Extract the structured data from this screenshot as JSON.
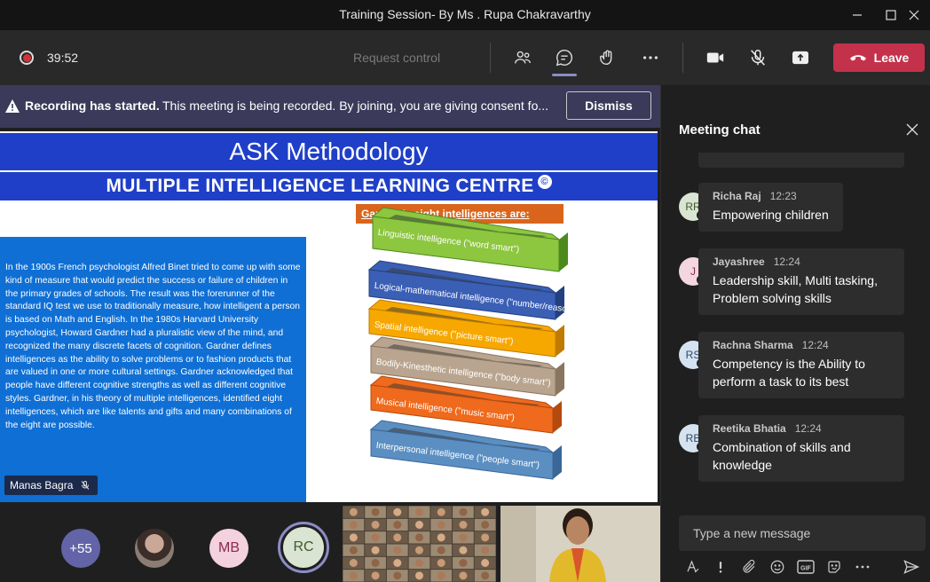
{
  "window": {
    "title": "Training Session- By Ms . Rupa Chakravarthy"
  },
  "toolbar": {
    "timer": "39:52",
    "request_control": "Request control",
    "leave_label": "Leave"
  },
  "banner": {
    "bold": "Recording has started.",
    "text": "This meeting is being recorded. By joining, you are giving consent fo...",
    "dismiss": "Dismiss"
  },
  "slide": {
    "title": "ASK Methodology",
    "subtitle": "MULTIPLE INTELLIGENCE LEARNING CENTRE",
    "copyright_mark": "©",
    "gardner_label": "Gardner's eight intelligences are:",
    "paragraph": "In the 1900s French psychologist Alfred Binet tried to come up with some kind of measure that would predict the success or failure of children in the primary grades of schools. The result was the forerunner of the standard IQ test we use to traditionally measure, how intelligent a person is based on Math and English. In the 1980s Harvard University psychologist, Howard Gardner had a pluralistic view of the mind, and recognized the many discrete facets of cognition. Gardner defines intelligences as the ability to solve problems or to fashion products that are valued in one or more cultural settings. Gardner acknowledged that people have different cognitive strengths as well as different cognitive styles. Gardner, in his theory of multiple intelligences, identified eight intelligences, which are like talents and gifts and many combinations of the eight are possible.",
    "layers": [
      {
        "label": "Linguistic intelligence (\"word smart\")",
        "color": "#8dc63f",
        "edge": "#4c8a1e"
      },
      {
        "label": "Logical-mathematical intelligence (\"number/reasoning smart\")",
        "color": "#3b5fb5",
        "edge": "#23407f"
      },
      {
        "label": "Spatial intelligence (\"picture smart\")",
        "color": "#f7a800",
        "edge": "#c17a00"
      },
      {
        "label": "Bodily-Kinesthetic intelligence (\"body smart\")",
        "color": "#b9a58f",
        "edge": "#8a7660"
      },
      {
        "label": "Musical intelligence (\"music smart\")",
        "color": "#ef6a1d",
        "edge": "#b44a0e"
      },
      {
        "label": "Interpersonal intelligence (\"people smart\")",
        "color": "#5b8fc2",
        "edge": "#3a6797"
      }
    ],
    "speaker": "Manas Bagra"
  },
  "participants": {
    "more_count": "+55",
    "mb_initials": "MB",
    "rc_initials": "RC"
  },
  "chat": {
    "title": "Meeting chat",
    "messages": [
      {
        "initials": "RR",
        "name": "Richa Raj",
        "time": "12:23",
        "text": "Empowering children",
        "status": "#c4314b",
        "avatar_bg": "#d9e4d2",
        "avatar_fg": "#3f5a2c"
      },
      {
        "initials": "J",
        "name": "Jayashree",
        "time": "12:24",
        "text": "Leadership skill, Multi tasking, Problem solving skills",
        "status": "#c4314b",
        "avatar_bg": "#f3d6df",
        "avatar_fg": "#8b2a4a"
      },
      {
        "initials": "RS",
        "name": "Rachna Sharma",
        "time": "12:24",
        "text": "Competency is the Ability to perform a task to its best",
        "status": "#c4314b",
        "avatar_bg": "#d5e2ef",
        "avatar_fg": "#2b4a6b"
      },
      {
        "initials": "RB",
        "name": "Reetika Bhatia",
        "time": "12:24",
        "text": "Combination of skills and knowledge",
        "status": "#f0b400",
        "avatar_bg": "#d5e2ef",
        "avatar_fg": "#2b4a6b"
      }
    ],
    "compose_placeholder": "Type a new message"
  },
  "colors": {
    "leave": "#c4314b",
    "slide_blue": "#1f3fc9",
    "banner": "#3b3a5a",
    "accent": "#8b8cc7"
  }
}
